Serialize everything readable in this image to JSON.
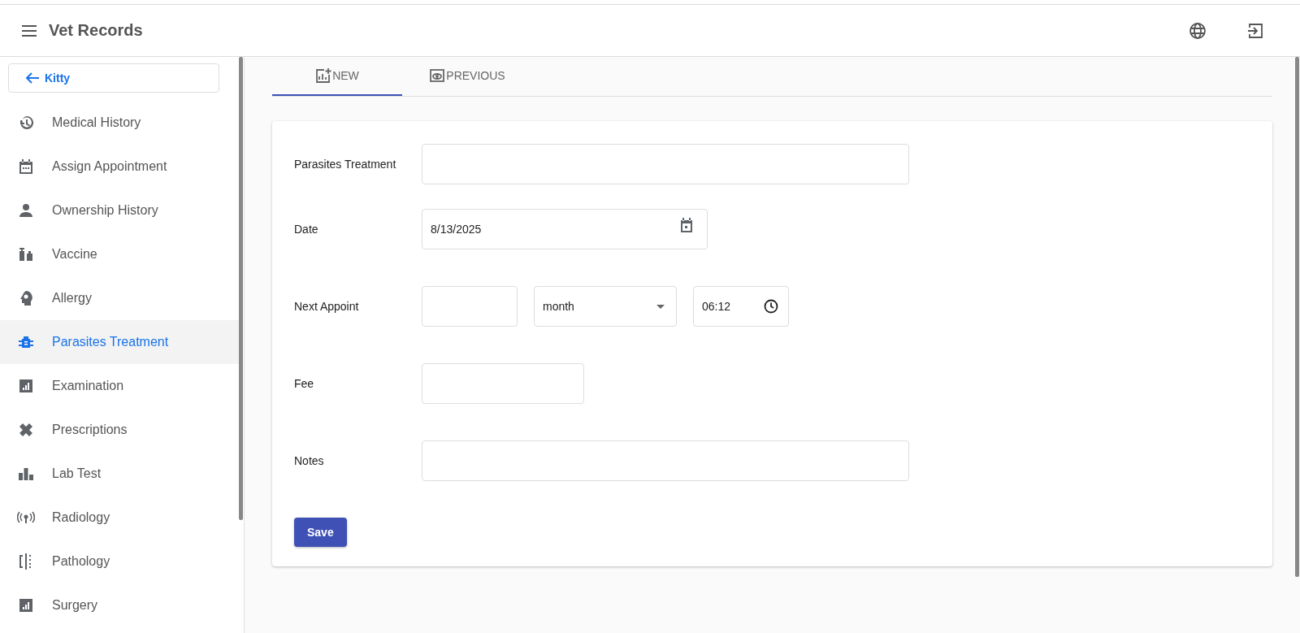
{
  "app_bar": {
    "title": "Vet Records"
  },
  "sidebar": {
    "back_button": "Kitty",
    "items": [
      {
        "label": "Medical History",
        "selected": false
      },
      {
        "label": "Assign Appointment",
        "selected": false
      },
      {
        "label": "Ownership History",
        "selected": false
      },
      {
        "label": "Vaccine",
        "selected": false
      },
      {
        "label": "Allergy",
        "selected": false
      },
      {
        "label": "Parasites Treatment",
        "selected": true
      },
      {
        "label": "Examination",
        "selected": false
      },
      {
        "label": "Prescriptions",
        "selected": false
      },
      {
        "label": "Lab Test",
        "selected": false
      },
      {
        "label": "Radiology",
        "selected": false
      },
      {
        "label": "Pathology",
        "selected": false
      },
      {
        "label": "Surgery",
        "selected": false
      }
    ]
  },
  "tabs": [
    {
      "label": "NEW",
      "selected": true
    },
    {
      "label": "PREVIOUS",
      "selected": false
    }
  ],
  "form": {
    "rows": [
      {
        "label": "Parasites Treatment",
        "fields": [
          {
            "kind": "text"
          }
        ]
      },
      {
        "label": "Date",
        "fields": [
          {
            "kind": "date",
            "value": "8/13/2025"
          }
        ]
      },
      {
        "label": "Next Appoint",
        "fields": [
          {
            "kind": "text"
          },
          {
            "kind": "select",
            "value": "month"
          },
          {
            "kind": "time",
            "value": "06:12"
          }
        ]
      },
      {
        "label": "Fee",
        "fields": [
          {
            "kind": "text"
          }
        ]
      },
      {
        "label": "Notes",
        "fields": [
          {
            "kind": "text"
          }
        ]
      }
    ],
    "save_button": "Save"
  }
}
